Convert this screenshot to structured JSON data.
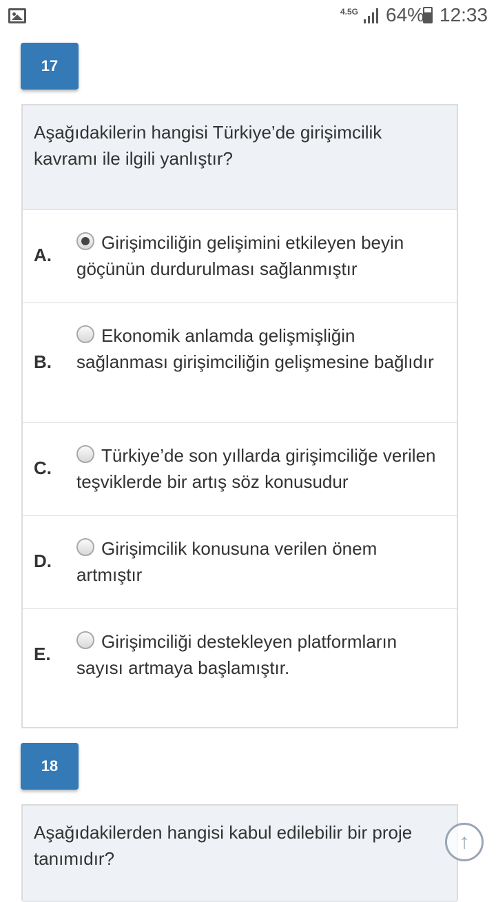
{
  "status_bar": {
    "network": "4.5G",
    "battery": "64%",
    "time": "12:33"
  },
  "questions": [
    {
      "number": "17",
      "text": "Aşağıdakilerin hangisi Türkiye’de girişimcilik kavramı ile ilgili yanlıştır?",
      "options": [
        {
          "letter": "A.",
          "text": "Girişimciliğin gelişimini etkileyen beyin göçünün durdurulması sağlanmıştır",
          "selected": true
        },
        {
          "letter": "B.",
          "text": "Ekonomik anlamda gelişmişliğin sağlanması girişimciliğin gelişmesine bağlıdır",
          "selected": false
        },
        {
          "letter": "C.",
          "text": "Türkiye’de son yıllarda girişimciliğe verilen teşviklerde bir artış söz konusudur",
          "selected": false
        },
        {
          "letter": "D.",
          "text": "Girişimcilik konusuna verilen önem artmıştır",
          "selected": false
        },
        {
          "letter": "E.",
          "text": "Girişimciliği destekleyen platformların sayısı artmaya başlamıştır.",
          "selected": false
        }
      ]
    },
    {
      "number": "18",
      "text": "Aşağıdakilerden hangisi kabul edilebilir bir proje tanımıdır?"
    }
  ],
  "icons": {
    "gallery": "gallery-icon",
    "signal": "signal-icon",
    "battery": "battery-icon",
    "scroll_top": "arrow-up-icon"
  }
}
